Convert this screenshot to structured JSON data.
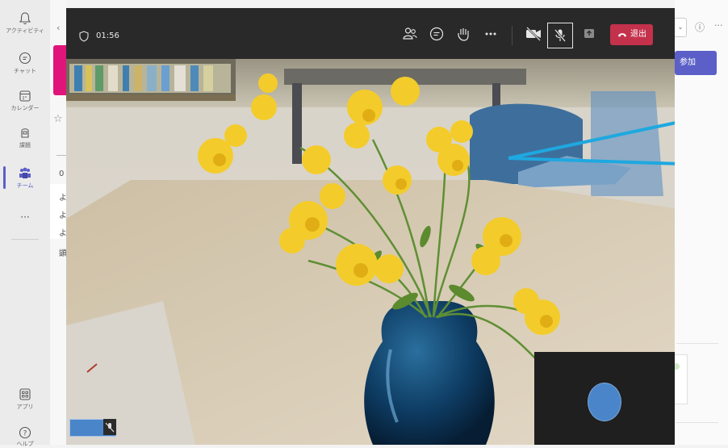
{
  "rail": {
    "items": [
      {
        "label": "アクティビティ",
        "icon": "bell-icon"
      },
      {
        "label": "チャット",
        "icon": "chat-icon"
      },
      {
        "label": "カレンダー",
        "icon": "calendar-icon"
      },
      {
        "label": "課題",
        "icon": "assignments-icon"
      },
      {
        "label": "チーム",
        "icon": "teams-icon"
      }
    ],
    "more": "···",
    "bottom": [
      {
        "label": "アプリ",
        "icon": "apps-icon"
      },
      {
        "label": "ヘルプ",
        "icon": "help-icon"
      }
    ]
  },
  "channel": {
    "back": "‹",
    "star": "☆",
    "lines": [
      "0",
      "よ",
      "よ",
      "よ",
      "顕"
    ]
  },
  "right": {
    "join": "参加",
    "dropdown": "⌄",
    "info": "ⓘ",
    "more": "···"
  },
  "meeting": {
    "timer": "01:56",
    "leave_label": "退出",
    "controls": [
      "participants-icon",
      "chat-icon",
      "reactions-icon",
      "more-icon",
      "camera-off-icon",
      "mic-off-icon",
      "share-icon"
    ],
    "colors": {
      "leave": "#c4314b",
      "accent": "#5b5fc7",
      "annotation": "#1ea8e0"
    }
  }
}
